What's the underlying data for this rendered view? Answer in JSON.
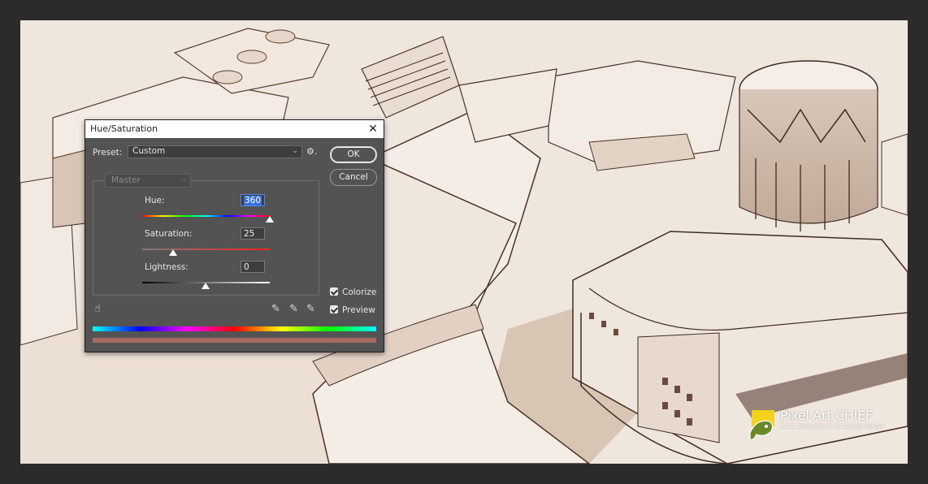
{
  "dialog": {
    "title": "Hue/Saturation",
    "close_glyph": "✕",
    "preset_label": "Preset:",
    "preset_value": "Custom",
    "ok_label": "OK",
    "cancel_label": "Cancel",
    "channel_value": "Master",
    "hue_label": "Hue:",
    "hue_value": "360",
    "saturation_label": "Saturation:",
    "saturation_value": "25",
    "lightness_label": "Lightness:",
    "lightness_value": "0",
    "colorize_label": "Colorize",
    "colorize_checked": true,
    "preview_label": "Preview",
    "preview_checked": true
  },
  "watermark": {
    "title": "Pixel Art CHIEF",
    "subtitle": "P.A.C. Education & Art Design Studio"
  },
  "colors": {
    "dialog_bg": "#535353",
    "title_bg": "#ffffff",
    "sepia_bg": "#efe6de",
    "colorized_bar": "#a56b60"
  },
  "icons": [
    "gear-icon",
    "hand-target-icon",
    "eyedropper-icon",
    "eyedropper-plus-icon",
    "eyedropper-minus-icon",
    "checkbox-icon",
    "chameleon-logo-icon"
  ]
}
